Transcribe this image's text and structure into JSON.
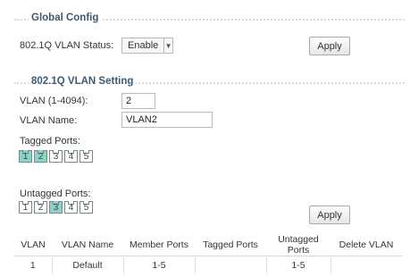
{
  "global_config": {
    "title": "Global Config",
    "vlan_status_label": "802.1Q VLAN Status:",
    "vlan_status_value": "Enable",
    "apply_label": "Apply"
  },
  "vlan_setting": {
    "title": "802.1Q VLAN Setting",
    "vlan_id_label": "VLAN (1-4094):",
    "vlan_id_value": "2",
    "vlan_name_label": "VLAN Name:",
    "vlan_name_value": "VLAN2",
    "tagged_ports_label": "Tagged Ports:",
    "tagged_ports": [
      {
        "label": "1",
        "selected": true
      },
      {
        "label": "2",
        "selected": true
      },
      {
        "label": "3",
        "selected": false
      },
      {
        "label": "4",
        "selected": false
      },
      {
        "label": "5",
        "selected": false
      }
    ],
    "untagged_ports_label": "Untagged Ports:",
    "untagged_ports": [
      {
        "label": "1",
        "selected": false
      },
      {
        "label": "2",
        "selected": false
      },
      {
        "label": "3",
        "selected": true
      },
      {
        "label": "4",
        "selected": false
      },
      {
        "label": "5",
        "selected": false
      }
    ],
    "apply_label": "Apply"
  },
  "vlan_table": {
    "headers": [
      "VLAN",
      "VLAN Name",
      "Member Ports",
      "Tagged Ports",
      "Untagged Ports",
      "Delete VLAN"
    ],
    "rows": [
      [
        "1",
        "Default",
        "1-5",
        "",
        "1-5",
        ""
      ]
    ]
  },
  "colors": {
    "section_title": "#3d5a73",
    "port_selected": "#8fd0c9"
  }
}
